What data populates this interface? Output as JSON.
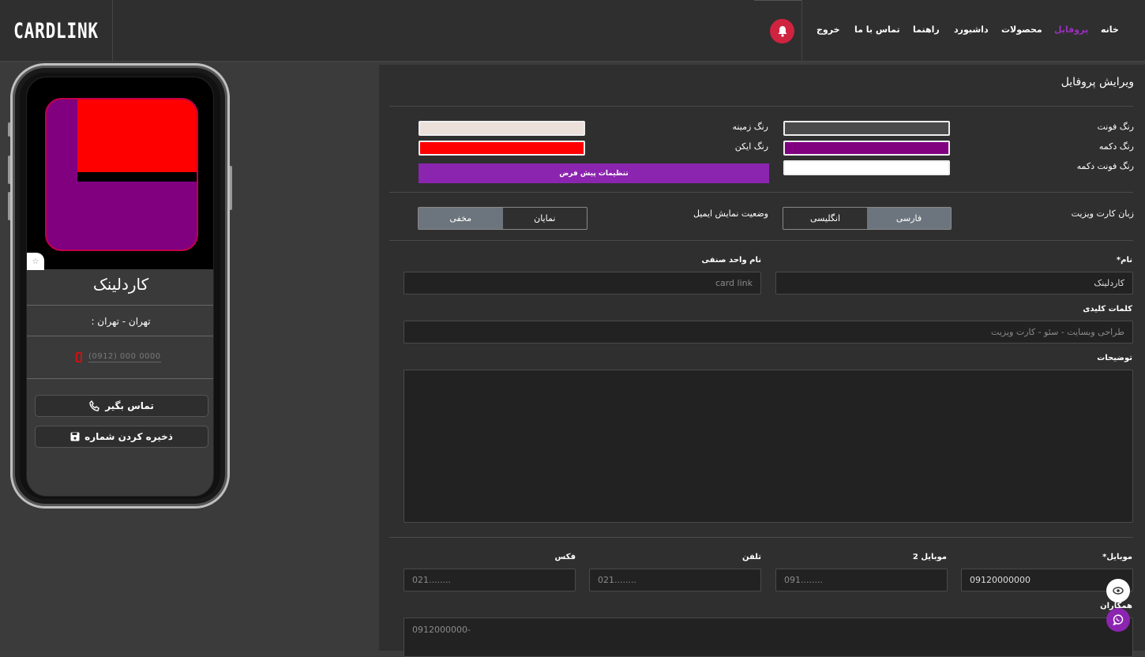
{
  "header": {
    "logo": "CARDLINK",
    "nav": [
      {
        "label": "خانه",
        "active": false
      },
      {
        "label": "پروفایل",
        "active": true
      },
      {
        "label": "محصولات",
        "active": false
      },
      {
        "label": "داشبورد",
        "active": false
      },
      {
        "label": "راهنما",
        "active": false
      },
      {
        "label": "تماس با ما",
        "active": false
      },
      {
        "label": "خروج",
        "active": false
      }
    ]
  },
  "preview": {
    "name": "کاردلینک",
    "address": "تهران - تهران :",
    "phone_placeholder": "(0912) 000 0000",
    "call_button": "تماس بگیر",
    "save_button": "ذخیره کردن شماره",
    "logo_colors": {
      "red": "#ff0000",
      "purple": "#800080"
    }
  },
  "form": {
    "title": "ویرایش پروفایل",
    "colors": {
      "font_color_label": "رنگ فونت",
      "font_color": "#4a4a4a",
      "button_color_label": "رنگ دکمه",
      "button_color": "#800080",
      "button_font_color_label": "رنگ فونت دکمه",
      "button_font_color": "#ffffff",
      "background_color_label": "رنگ زمینه",
      "background_color": "#ebe0da",
      "icon_color_label": "رنگ ایکن",
      "icon_color": "#ff0000",
      "default_button": "تنظیمات پیش فرض"
    },
    "language": {
      "label": "زبان کارت ویزیت",
      "options": [
        "فارسی",
        "انگلیسی"
      ],
      "selected": "فارسی"
    },
    "email_display": {
      "label": "وضعیت نمایش ایمیل",
      "options": [
        "نمایان",
        "مخفی"
      ],
      "selected": "مخفی"
    },
    "name": {
      "label": "نام*",
      "value": "کاردلینک"
    },
    "business": {
      "label": "نام واحد صنفی",
      "placeholder": "card link"
    },
    "keywords": {
      "label": "کلمات کلیدی",
      "placeholder": "طراحی وبسایت - سئو - کارت ویزیت"
    },
    "description": {
      "label": "توضیحات"
    },
    "mobile": {
      "label": "موبایل*",
      "value": "09120000000"
    },
    "mobile2": {
      "label": "موبایل 2",
      "placeholder": "091........"
    },
    "phone": {
      "label": "تلفن",
      "placeholder": "021........"
    },
    "fax": {
      "label": "فکس",
      "placeholder": "021........"
    },
    "colleagues": {
      "label": "همکاران",
      "placeholder": "0912000000-"
    }
  }
}
